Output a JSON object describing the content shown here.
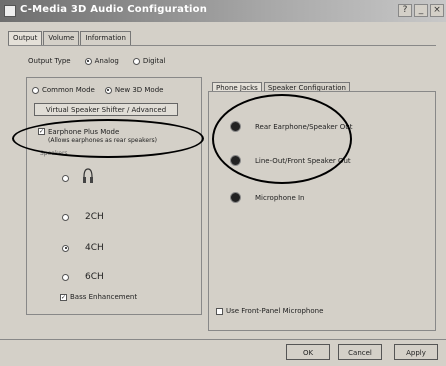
{
  "window": {
    "title": "C-Media 3D Audio Configuration"
  },
  "tabs": [
    "Output",
    "Volume",
    "Information"
  ],
  "output_type": {
    "label": "Output Type",
    "options": [
      "Analog",
      "Digital"
    ],
    "selected": "Analog"
  },
  "modes": {
    "options": [
      "Common Mode",
      "New 3D Mode"
    ],
    "selected": "New 3D Mode"
  },
  "virtual_speaker_button": "Virtual Speaker Shifter / Advanced",
  "earphone": {
    "line1": "Earphone Plus Mode",
    "line2": "(Allows earphones as rear speakers)",
    "checked": true
  },
  "speakers_label": "Speakers",
  "channels": [
    {
      "label": "",
      "selected": false
    },
    {
      "label": "2CH",
      "selected": false
    },
    {
      "label": "4CH",
      "selected": true
    },
    {
      "label": "6CH",
      "selected": false
    }
  ],
  "bass": {
    "label": "Bass Enhancement",
    "checked": true
  },
  "right_tabs": [
    "Phone Jacks",
    "Speaker Configuration"
  ],
  "jacks": [
    "Rear Earphone/Speaker Out",
    "Line-Out/Front Speaker Out",
    "Microphone In"
  ],
  "front_mic": {
    "label": "Use Front-Panel Microphone",
    "checked": false
  },
  "buttons": {
    "ok": "OK",
    "cancel": "Cancel",
    "apply": "Apply"
  },
  "icons": {
    "app": "speaker-app-icon",
    "headphone": "headphone-icon"
  }
}
